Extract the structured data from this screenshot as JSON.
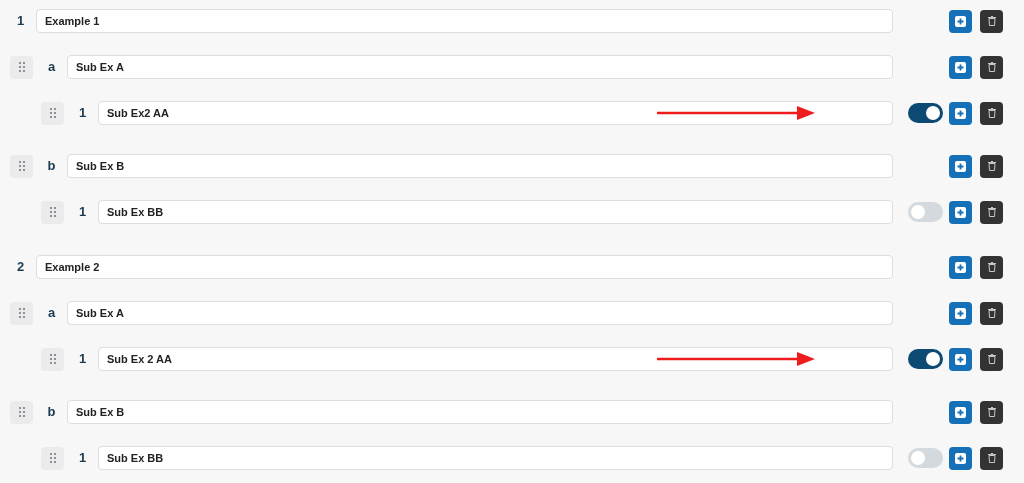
{
  "items": [
    {
      "label": "1",
      "value": "Example 1",
      "children": [
        {
          "label": "a",
          "value": "Sub Ex A",
          "children": [
            {
              "label": "1",
              "value": "Sub Ex2 AA",
              "on": true,
              "arrow": true
            }
          ]
        },
        {
          "label": "b",
          "value": "Sub Ex B",
          "children": [
            {
              "label": "1",
              "value": "Sub Ex BB",
              "on": false,
              "arrow": false
            }
          ]
        }
      ]
    },
    {
      "label": "2",
      "value": "Example 2",
      "children": [
        {
          "label": "a",
          "value": "Sub Ex A",
          "children": [
            {
              "label": "1",
              "value": "Sub Ex 2 AA",
              "on": true,
              "arrow": true
            }
          ]
        },
        {
          "label": "b",
          "value": "Sub Ex B",
          "children": [
            {
              "label": "1",
              "value": "Sub Ex BB",
              "on": false,
              "arrow": false
            }
          ]
        }
      ]
    }
  ]
}
